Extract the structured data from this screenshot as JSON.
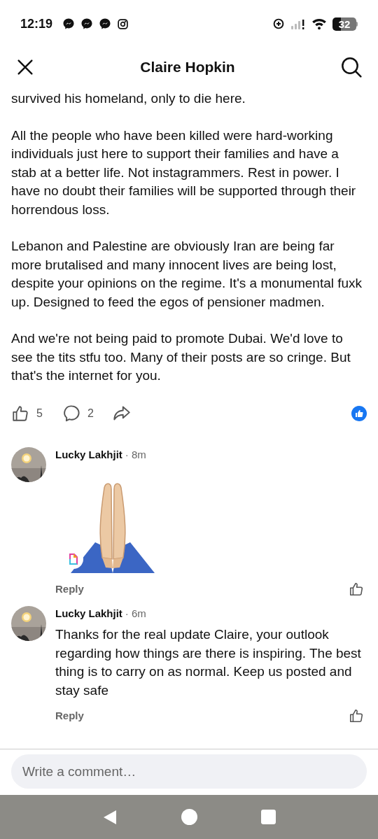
{
  "status_bar": {
    "time": "12:19",
    "battery": "32"
  },
  "header": {
    "title": "Claire Hopkin"
  },
  "post": {
    "paragraphs": [
      "survived his homeland, only to die here.",
      "All the people who have been killed were hard-working individuals just here to support their families and have a stab at a better life. Not instagrammers. Rest in power. I have no doubt their families will be supported through their horrendous loss.",
      "Lebanon and Palestine are obviously Iran are being far more brutalised and many innocent lives are being lost, despite your opinions on the regime. It's a monumental fuxk up. Designed to feed the egos of pensioner madmen.",
      "And we're not being paid to promote Dubai. We'd love to see the tits stfu too. Many of their posts are so cringe. But that's the internet for you."
    ],
    "likes": "5",
    "comments": "2"
  },
  "comments": [
    {
      "author": "Lucky Lakhjit",
      "time": "· 8m",
      "kind": "sticker",
      "reply": "Reply"
    },
    {
      "author": "Lucky Lakhjit",
      "time": "· 6m",
      "kind": "text",
      "text": "Thanks for the real update Claire, your outlook regarding how things are there is inspiring. The best thing is to carry on as normal. Keep us posted and stay safe",
      "reply": "Reply"
    }
  ],
  "composer": {
    "placeholder": "Write a comment…"
  }
}
